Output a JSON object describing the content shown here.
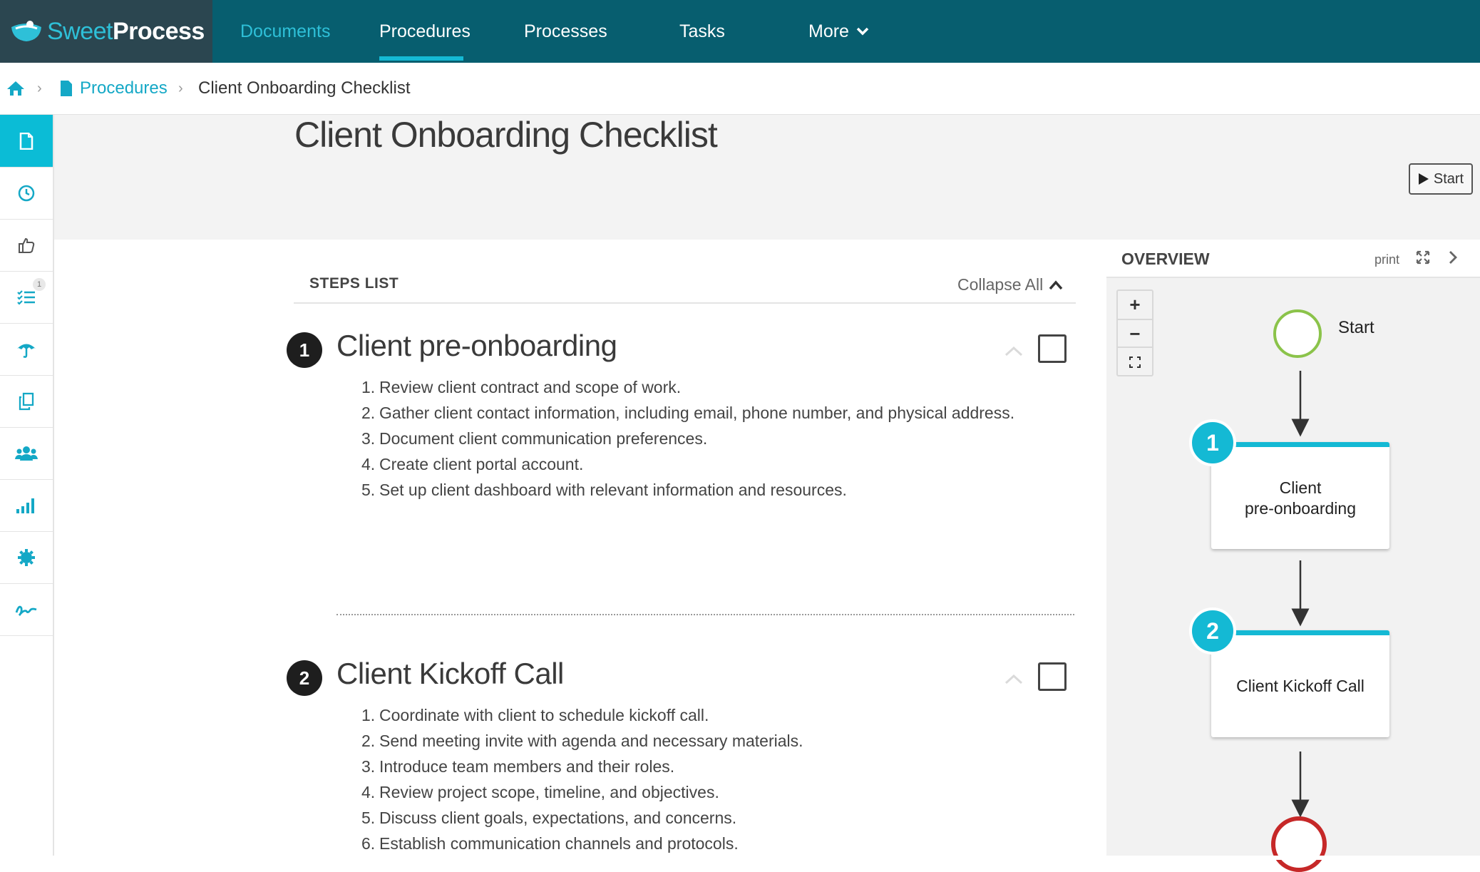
{
  "brand": {
    "name_part1": "Sweet",
    "name_part2": "Process",
    "accent": "#14b9d4",
    "nav_bg": "#075e6f"
  },
  "nav": {
    "documents": "Documents",
    "procedures": "Procedures",
    "processes": "Processes",
    "tasks": "Tasks",
    "more": "More"
  },
  "breadcrumb": {
    "home_icon": "home-icon",
    "section": "Procedures",
    "current": "Client Onboarding Checklist"
  },
  "sidebar": {
    "items": [
      {
        "icon": "document-icon",
        "active": true
      },
      {
        "icon": "clock-icon"
      },
      {
        "icon": "thumbs-up-icon"
      },
      {
        "icon": "checklist-icon",
        "badge": "1"
      },
      {
        "icon": "umbrella-icon"
      },
      {
        "icon": "copy-icon"
      },
      {
        "icon": "users-icon"
      },
      {
        "icon": "bar-chart-icon"
      },
      {
        "icon": "gear-icon"
      },
      {
        "icon": "signature-icon"
      }
    ]
  },
  "page": {
    "title": "Client Onboarding Checklist",
    "start_label": "Start"
  },
  "steps_list": {
    "title": "STEPS LIST",
    "collapse_all": "Collapse All",
    "steps": [
      {
        "number": "1",
        "title": "Client pre-onboarding",
        "items": [
          "Review client contract and scope of work.",
          "Gather client contact information, including email, phone number, and physical address.",
          "Document client communication preferences.",
          "Create client portal account.",
          "Set up client dashboard with relevant information and resources."
        ]
      },
      {
        "number": "2",
        "title": "Client Kickoff Call",
        "items": [
          "Coordinate with client to schedule kickoff call.",
          "Send meeting invite with agenda and necessary materials.",
          "Introduce team members and their roles.",
          "Review project scope, timeline, and objectives.",
          "Discuss client goals, expectations, and concerns.",
          "Establish communication channels and protocols."
        ]
      }
    ]
  },
  "overview": {
    "title": "OVERVIEW",
    "print": "print",
    "zoom_in": "+",
    "zoom_out": "−",
    "start_node": "Start",
    "nodes": [
      {
        "number": "1",
        "line1": "Client",
        "line2": "pre-onboarding"
      },
      {
        "number": "2",
        "line1": "Client Kickoff Call",
        "line2": ""
      }
    ]
  }
}
